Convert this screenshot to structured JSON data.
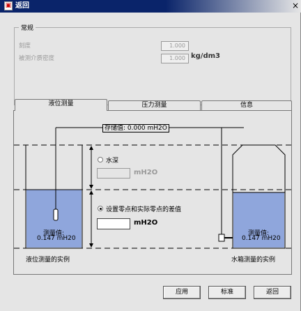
{
  "window": {
    "title": "返回",
    "close_glyph": "×"
  },
  "general": {
    "legend": "常规",
    "scale_label": "刻度",
    "scale_value": "1.000",
    "density_label": "被测介质密度",
    "density_value": "1.000",
    "density_unit": "kg/dm3"
  },
  "tabs": [
    {
      "label": "液位测量",
      "active": true
    },
    {
      "label": "压力测量",
      "active": false
    },
    {
      "label": "信息",
      "active": false
    }
  ],
  "diagram": {
    "stored_value": "存储值: 0.000 mH2O",
    "water_depth_label": "水深",
    "water_depth_unit": "mH2O",
    "offset_label": "设置零点和实际零点的差值",
    "offset_unit": "mH2O",
    "left_measured": "测量值:",
    "left_measured_value": "0.147 mH20",
    "right_measured": "测量值:",
    "right_measured_value": "0.147 mH20",
    "left_caption": "液位测量的实例",
    "right_caption": "水箱测量的实例",
    "water_color": "#8fa6dc"
  },
  "buttons": {
    "apply": "应用",
    "standard": "标准",
    "back": "返回"
  }
}
